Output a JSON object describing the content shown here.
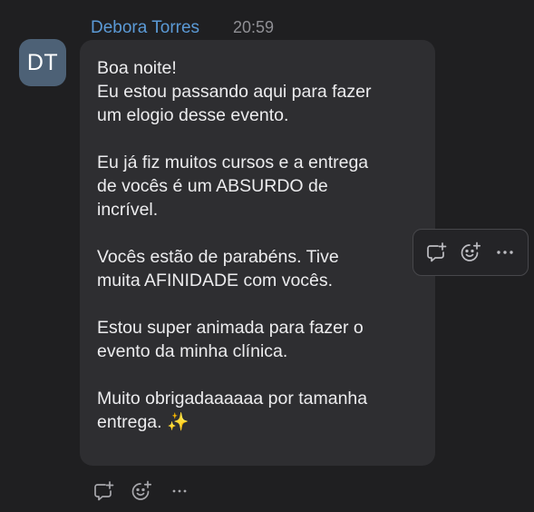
{
  "message": {
    "sender": "Debora Torres",
    "time": "20:59",
    "avatar_initials": "DT",
    "avatar_color": "#4d6176",
    "sender_color": "#5b9ad6",
    "paragraphs": [
      "Boa noite!\nEu estou passando aqui para fazer\num elogio desse evento.",
      "Eu já fiz muitos cursos e a entrega\nde vocês é um ABSURDO de\nincrível.",
      "Vocês estão de parabéns. Tive\nmuita AFINIDADE com vocês.",
      "Estou super animada para fazer o\nevento da minha clínica.",
      "Muito obrigadaaaaaa por tamanha\nentrega."
    ],
    "last_emoji": "✨"
  },
  "actions": {
    "icons": [
      "reply-thread-icon",
      "add-reaction-icon",
      "more-options-icon"
    ],
    "more_label": "···"
  }
}
